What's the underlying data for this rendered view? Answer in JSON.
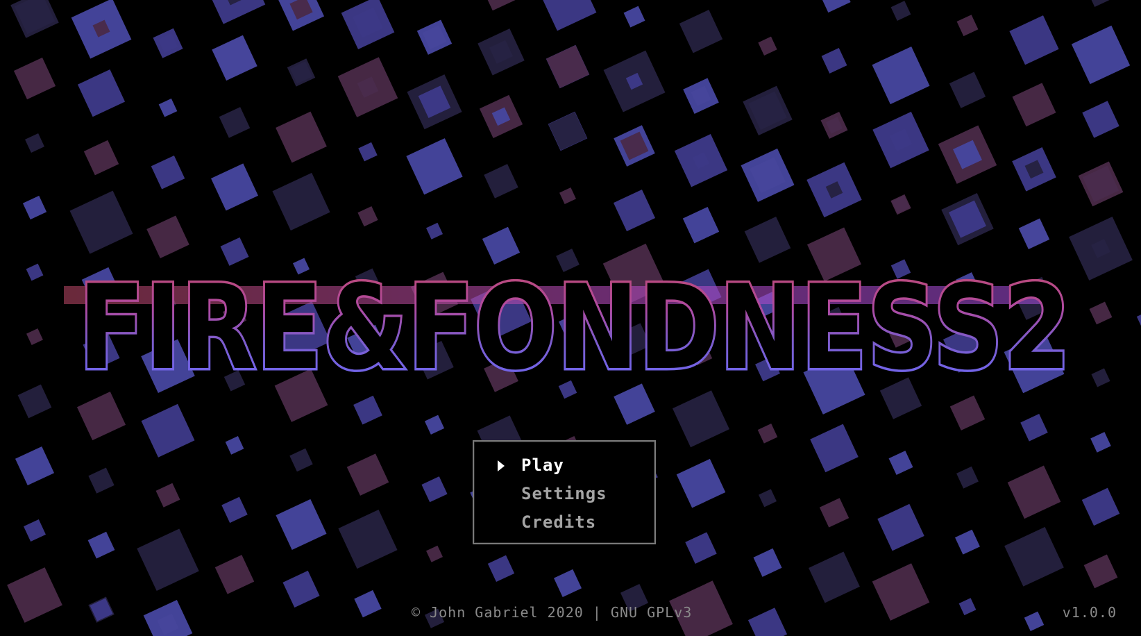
{
  "title": {
    "text": "FIRE&FONDNESS2",
    "gradient_top": "#c04a6a",
    "gradient_bottom": "#6b6bff"
  },
  "menu": {
    "items": [
      {
        "label": "Play",
        "selected": true
      },
      {
        "label": "Settings",
        "selected": false
      },
      {
        "label": "Credits",
        "selected": false
      }
    ]
  },
  "footer": {
    "copyright": "© John Gabriel 2020 | GNU GPLv3",
    "version": "v1.0.0"
  },
  "colors": {
    "background": "#000000",
    "tile_colors": [
      "#3e3a8a",
      "#4a2a48",
      "#25213f",
      "#4747a0"
    ]
  }
}
